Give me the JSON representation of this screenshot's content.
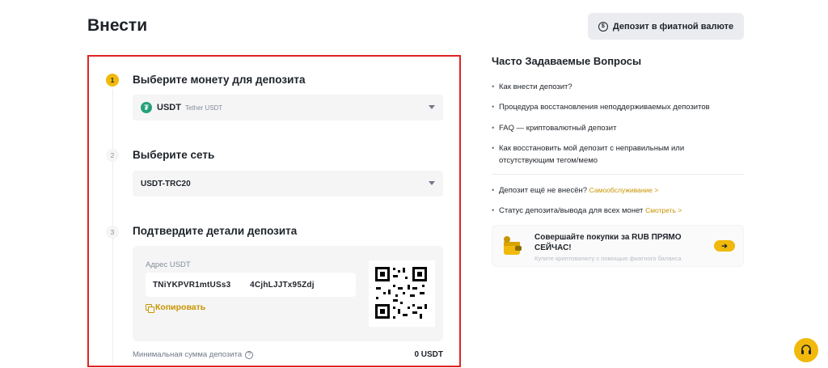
{
  "header": {
    "title": "Внести",
    "fiat_button_label": "Депозит в фиатной валюте"
  },
  "steps": [
    {
      "number": "1",
      "title": "Выберите монету для депозита"
    },
    {
      "number": "2",
      "title": "Выберите сеть"
    },
    {
      "number": "3",
      "title": "Подтвердите детали депозита"
    }
  ],
  "coin_select": {
    "icon_glyph": "₮",
    "code": "USDT",
    "name": "Tether USDT"
  },
  "network_select": {
    "value": "USDT-TRC20"
  },
  "deposit_details": {
    "address_label": "Адрес USDT",
    "address": "TNiYKPVR1mtUSs3        4CjhLJJTx95Zdj",
    "copy_label": "Копировать",
    "min_label": "Минимальная сумма депозита",
    "min_value": "0 USDT"
  },
  "faq": {
    "title": "Часто Задаваемые Вопросы",
    "items": [
      "Как внести депозит?",
      "Процедура восстановления неподдерживаемых депозитов",
      "FAQ — криптовалютный депозит",
      "Как восстановить мой депозит с неправильным или отсутствующим тегом/мемо"
    ],
    "not_credited_text": "Депозит ещё не внесён?",
    "self_service_link": "Самообслуживание >",
    "status_text": "Статус депозита/вывода для всех монет",
    "view_link": "Смотреть >"
  },
  "promo": {
    "title": "Совершайте покупки за RUB ПРЯМО СЕЙЧАС!",
    "subtitle": "Купите криптовалюту с помощью фиатного баланса",
    "arrow": "➔"
  },
  "colors": {
    "accent": "#f0b90b",
    "link": "#c99400",
    "highlight_border": "#e02424",
    "coin": "#26a17b"
  }
}
